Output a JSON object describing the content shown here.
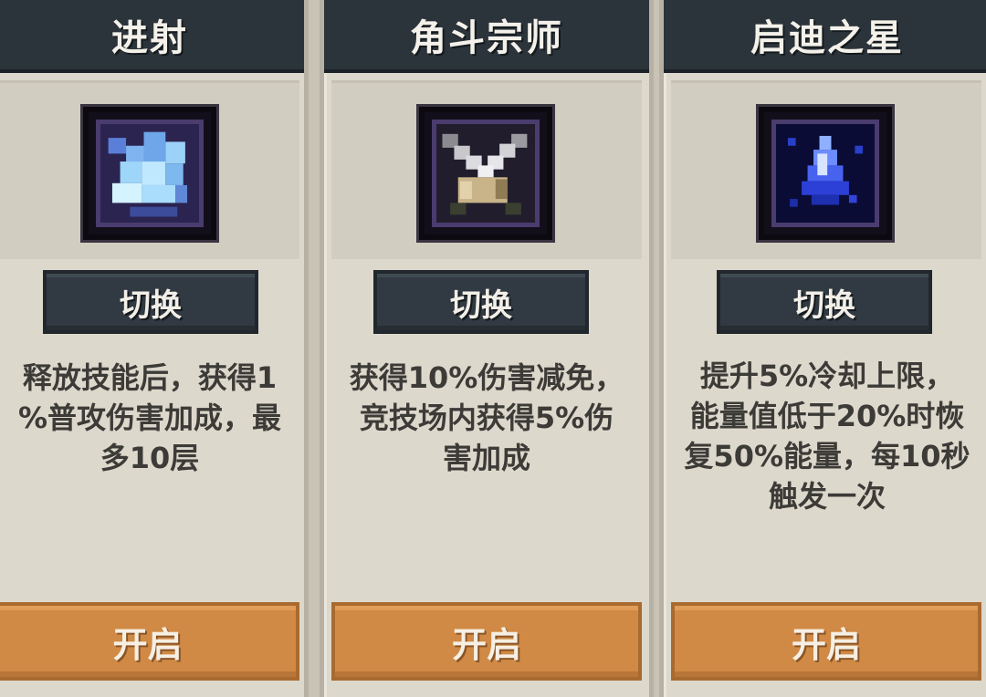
{
  "cards": [
    {
      "title": "进射",
      "icon": "ice-blade-icon",
      "switch_label": "切换",
      "description": [
        "释放技能后，获得1",
        "%普攻伤害加成，最",
        "多10层"
      ],
      "open_label": "开启"
    },
    {
      "title": "角斗宗师",
      "icon": "crossed-swords-icon",
      "switch_label": "切换",
      "description": [
        "获得10%伤害减免，",
        "竞技场内获得5%伤",
        "害加成"
      ],
      "open_label": "开启"
    },
    {
      "title": "启迪之星",
      "icon": "blue-star-crystal-icon",
      "switch_label": "切换",
      "description": [
        "提升5%冷却上限，",
        "能量值低于20%时恢",
        "复50%能量，每10秒",
        "触发一次"
      ],
      "open_label": "开启"
    }
  ],
  "colors": {
    "header": "#2c343b",
    "card_bg": "#ddd8cc",
    "switch_button": "#313a42",
    "open_button": "#d08a45",
    "text": "#3d3b37"
  }
}
